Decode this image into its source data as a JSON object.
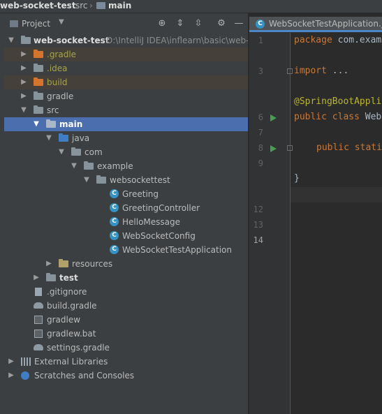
{
  "breadcrumb": {
    "project": "web-socket-test",
    "folder1": "src",
    "folder2": "main"
  },
  "project_panel": {
    "view_label": "Project",
    "tree": [
      {
        "label": "web-socket-test",
        "path": "D:\\IntelliJ IDEA\\inflearn\\basic\\web-",
        "kind": "module",
        "expanded": true,
        "bold": true
      },
      {
        "label": ".gradle",
        "kind": "folder-excluded",
        "expanded": false
      },
      {
        "label": ".idea",
        "kind": "folder",
        "expanded": false
      },
      {
        "label": "build",
        "kind": "folder-excluded",
        "expanded": false
      },
      {
        "label": "gradle",
        "kind": "folder",
        "expanded": false
      },
      {
        "label": "src",
        "kind": "folder",
        "expanded": true
      },
      {
        "label": "main",
        "kind": "source-root",
        "expanded": true,
        "selected": true
      },
      {
        "label": "java",
        "kind": "java-folder",
        "expanded": true
      },
      {
        "label": "com",
        "kind": "package",
        "expanded": true
      },
      {
        "label": "example",
        "kind": "package",
        "expanded": true
      },
      {
        "label": "websockettest",
        "kind": "package",
        "expanded": true
      },
      {
        "label": "Greeting",
        "kind": "class"
      },
      {
        "label": "GreetingController",
        "kind": "class"
      },
      {
        "label": "HelloMessage",
        "kind": "class"
      },
      {
        "label": "WebSocketConfig",
        "kind": "class"
      },
      {
        "label": "WebSocketTestApplication",
        "kind": "class"
      },
      {
        "label": "resources",
        "kind": "resources",
        "expanded": false
      },
      {
        "label": "test",
        "kind": "folder",
        "expanded": false,
        "bold": true
      },
      {
        "label": ".gitignore",
        "kind": "file"
      },
      {
        "label": "build.gradle",
        "kind": "gradle-file"
      },
      {
        "label": "gradlew",
        "kind": "file"
      },
      {
        "label": "gradlew.bat",
        "kind": "file"
      },
      {
        "label": "settings.gradle",
        "kind": "gradle-file"
      },
      {
        "label": "External Libraries",
        "kind": "libraries",
        "expanded": false
      },
      {
        "label": "Scratches and Consoles",
        "kind": "scratches",
        "expanded": false
      }
    ]
  },
  "editor": {
    "tab_label": "WebSocketTestApplication.java",
    "line_numbers": [
      "1",
      "3",
      "6",
      "7",
      "8",
      "9",
      "12",
      "13",
      "14"
    ],
    "code": {
      "l1": [
        "package",
        " com.exam"
      ],
      "l3": [
        "import",
        " ..."
      ],
      "l6": "@SpringBootAppli",
      "l7": [
        "public class",
        " Web"
      ],
      "l9": "public stati",
      "l13": "}"
    }
  },
  "colors": {
    "accent": "#4b6eaf",
    "keyword": "#cc7832",
    "annotation": "#bbb529",
    "run": "#499c54"
  }
}
